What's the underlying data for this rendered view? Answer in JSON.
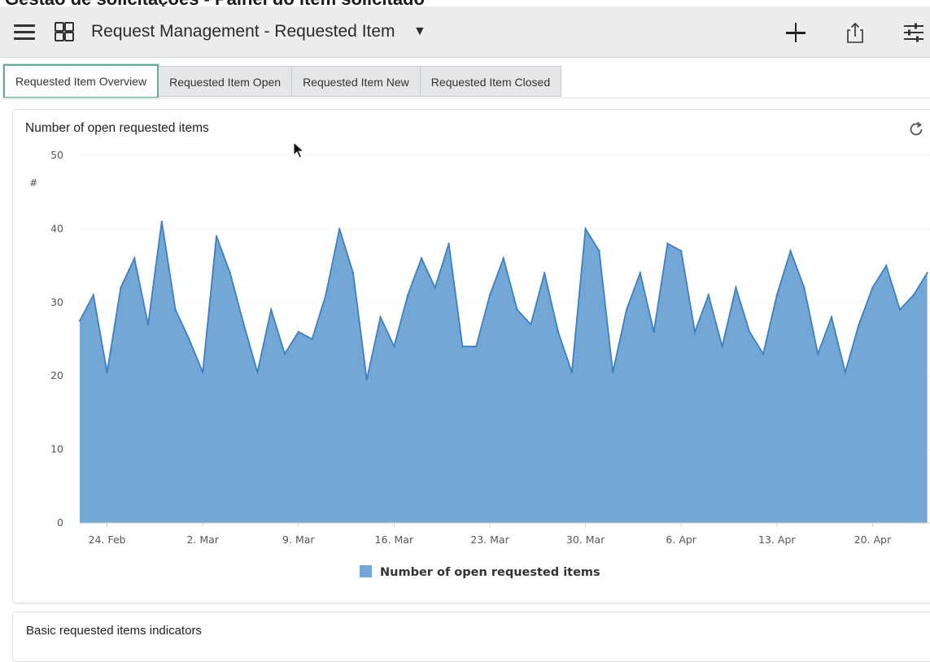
{
  "caption": "Gestão de solicitações - Painel do item solicitado",
  "header": {
    "title": "Request Management - Requested Item",
    "caret": "▼",
    "icons": [
      "hamburger-icon",
      "grid-icon",
      "plus-icon",
      "share-icon",
      "filter-icon"
    ]
  },
  "tabs": [
    {
      "label": "Requested Item Overview",
      "active": true
    },
    {
      "label": "Requested Item Open",
      "active": false
    },
    {
      "label": "Requested Item New",
      "active": false
    },
    {
      "label": "Requested Item Closed",
      "active": false
    }
  ],
  "panel": {
    "title": "Number of open requested items",
    "refresh_icon": "refresh-icon"
  },
  "chart_data": {
    "type": "area",
    "title": "Number of open requested items",
    "ylabel": "#",
    "ylim": [
      0,
      50
    ],
    "yticks": [
      0,
      10,
      20,
      30,
      40,
      50
    ],
    "xtick_labels": [
      "24. Feb",
      "2. Mar",
      "9. Mar",
      "16. Mar",
      "23. Mar",
      "30. Mar",
      "6. Apr",
      "13. Apr",
      "20. Apr"
    ],
    "legend": "bottom-center",
    "color": "#72a7d6",
    "line_color": "#3f7fbf",
    "grid": true,
    "series": [
      {
        "name": "Number of open requested items",
        "x_start": "2020-02-22",
        "x_step_days": 1,
        "values": [
          27.5,
          31,
          20.5,
          32,
          36,
          27,
          41,
          29,
          25,
          20.5,
          39,
          34,
          27,
          20.5,
          29,
          23,
          26,
          25,
          31,
          40,
          34,
          19.5,
          28,
          24,
          31,
          36,
          32,
          38,
          24,
          24,
          31,
          36,
          29,
          27,
          34,
          26,
          20.5,
          40,
          37,
          20.5,
          29,
          34,
          26,
          38,
          37,
          26,
          31,
          24,
          32,
          26,
          23,
          31,
          37,
          32,
          23,
          28,
          20.5,
          27,
          32,
          35,
          29,
          31,
          34
        ]
      }
    ]
  },
  "second_panel": {
    "title": "Basic requested items indicators"
  }
}
